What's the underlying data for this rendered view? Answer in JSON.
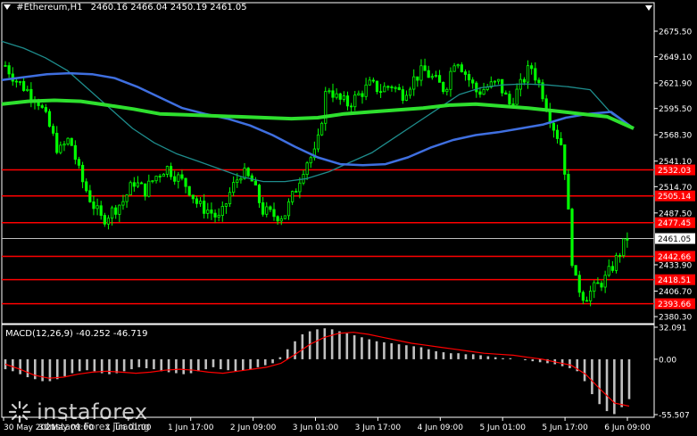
{
  "header": {
    "symbol": "#Ethereum,H1",
    "ohlc": "2460.16 2466.04 2450.19 2461.05"
  },
  "macd_header": "MACD(12,26,9) -40.252 -46.719",
  "watermark": {
    "brand": "instaforex",
    "sub": "Instant Forex Trading"
  },
  "colors": {
    "background": "#000000",
    "candle": "#00ff00",
    "ma_fast": "#3f6fe0",
    "ma_teal": "#1e8c8c",
    "ma_slow": "#2ee02e",
    "level_line": "#ff0000",
    "macd_hist": "#c0c0c0",
    "macd_signal": "#ff0000"
  },
  "chart_data": {
    "type": "candlestick",
    "symbol": "#Ethereum",
    "timeframe": "H1",
    "ylim": [
      2373,
      2693
    ],
    "y_ticks": [
      "2675.50",
      "2649.10",
      "2621.90",
      "2595.50",
      "2568.30",
      "2541.10",
      "2514.70",
      "2487.50",
      "2433.90",
      "2406.70",
      "2380.30"
    ],
    "y_tick_values": [
      2675.5,
      2649.1,
      2621.9,
      2595.5,
      2568.3,
      2541.1,
      2514.7,
      2487.5,
      2433.9,
      2406.7,
      2380.3
    ],
    "x_ticks": [
      "30 May 2021",
      "31 May 09:00",
      "1 Jun 01:00",
      "1 Jun 17:00",
      "2 Jun 09:00",
      "3 Jun 01:00",
      "3 Jun 17:00",
      "4 Jun 09:00",
      "5 Jun 01:00",
      "5 Jun 17:00",
      "6 Jun 09:00"
    ],
    "levels": [
      2532.03,
      2505.14,
      2477.45,
      2442.66,
      2418.51,
      2393.66
    ],
    "level_labels": [
      "2532.03",
      "2505.14",
      "2477.45",
      "2442.66",
      "2418.51",
      "2393.66"
    ],
    "current_price": 2461.05,
    "current_price_label": "2461.05",
    "price_path": [
      2640,
      2625,
      2615,
      2605,
      2580,
      2550,
      2565,
      2525,
      2500,
      2480,
      2490,
      2500,
      2520,
      2510,
      2525,
      2535,
      2525,
      2515,
      2495,
      2490,
      2480,
      2510,
      2530,
      2520,
      2490,
      2485,
      2485,
      2510,
      2540,
      2550,
      2620,
      2605,
      2600,
      2610,
      2620,
      2615,
      2620,
      2610,
      2625,
      2635,
      2625,
      2615,
      2650,
      2630,
      2612,
      2618,
      2622,
      2600,
      2618,
      2640,
      2615,
      2580,
      2555,
      2420,
      2400,
      2410,
      2420,
      2440,
      2462
    ],
    "ma_fast_path": [
      2625,
      2628,
      2631,
      2632,
      2631,
      2627,
      2618,
      2607,
      2596,
      2590,
      2585,
      2578,
      2568,
      2556,
      2545,
      2538,
      2537,
      2538,
      2545,
      2555,
      2563,
      2568,
      2571,
      2575,
      2579,
      2586,
      2590,
      2592,
      2575
    ],
    "ma_teal_path": [
      2665,
      2658,
      2648,
      2635,
      2615,
      2595,
      2575,
      2560,
      2549,
      2541,
      2533,
      2525,
      2520,
      2520,
      2523,
      2530,
      2540,
      2550,
      2565,
      2580,
      2595,
      2610,
      2617,
      2620,
      2621,
      2620,
      2618,
      2615,
      2590,
      2575
    ],
    "ma_slow_path": [
      2600,
      2603,
      2604,
      2603,
      2599,
      2595,
      2590,
      2589,
      2588,
      2587,
      2586,
      2585,
      2586,
      2590,
      2592,
      2594,
      2596,
      2599,
      2600,
      2598,
      2596,
      2593,
      2590,
      2587,
      2575
    ],
    "macd": {
      "label": "MACD(12,26,9)",
      "main": -40.252,
      "signal": -46.719,
      "ylim": [
        -55.507,
        32.091
      ],
      "y_ticks": [
        "32.091",
        "0.00",
        "-55.507"
      ],
      "y_tick_values": [
        32.091,
        0,
        -55.507
      ],
      "histogram": [
        -10,
        -12,
        -15,
        -18,
        -20,
        -22,
        -22,
        -20,
        -17,
        -14,
        -12,
        -11,
        -12,
        -14,
        -15,
        -14,
        -12,
        -10,
        -8,
        -9,
        -10,
        -12,
        -13,
        -14,
        -15,
        -14,
        -12,
        -10,
        -8,
        -10,
        -11,
        -12,
        -11,
        -10,
        -8,
        -6,
        -4,
        2,
        10,
        18,
        25,
        28,
        30,
        31,
        30,
        28,
        26,
        24,
        22,
        20,
        18,
        17,
        16,
        15,
        14,
        13,
        12,
        10,
        8,
        7,
        6,
        6,
        5,
        5,
        4,
        3,
        2,
        1,
        1,
        0,
        -1,
        -2,
        -3,
        -4,
        -5,
        -7,
        -9,
        -12,
        -22,
        -35,
        -45,
        -52,
        -55,
        -48,
        -40
      ],
      "signal_path": [
        -5,
        -10,
        -16,
        -19,
        -18,
        -15,
        -13,
        -12,
        -13,
        -14,
        -13,
        -11,
        -10,
        -11,
        -13,
        -14,
        -12,
        -10,
        -8,
        -4,
        5,
        15,
        22,
        26,
        27,
        25,
        22,
        19,
        16,
        14,
        12,
        10,
        8,
        6,
        5,
        4,
        2,
        0,
        -3,
        -6,
        -15,
        -30,
        -44,
        -47
      ]
    }
  }
}
